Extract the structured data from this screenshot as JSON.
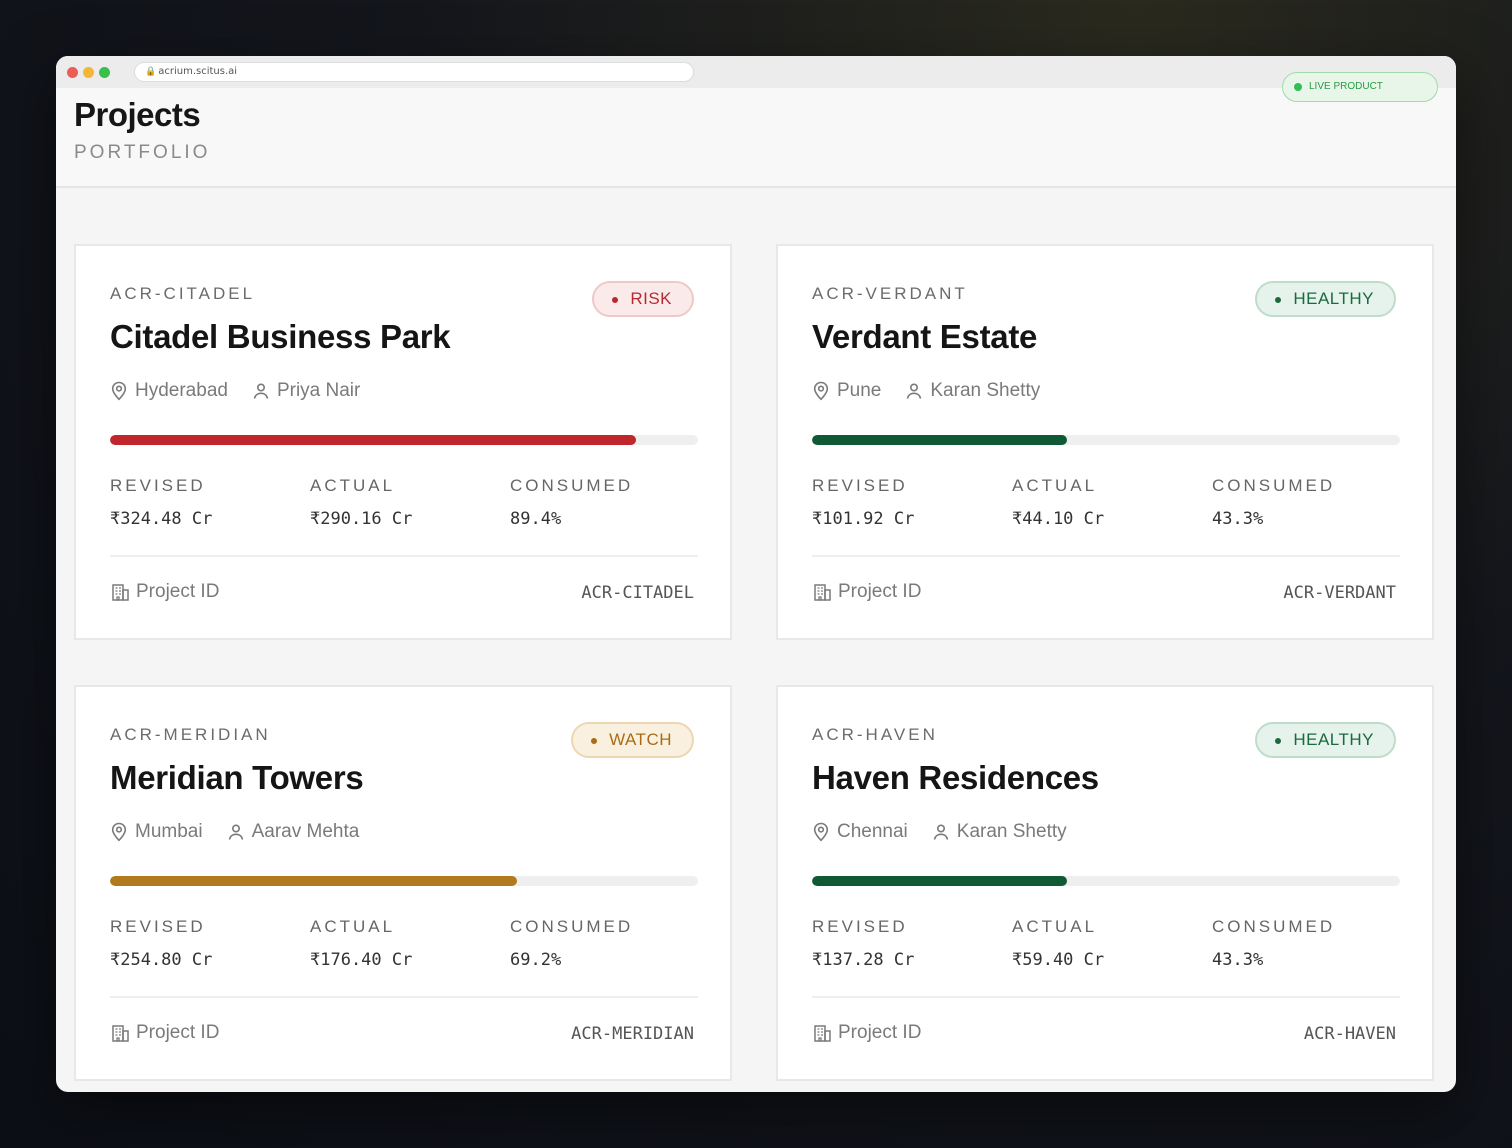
{
  "browser": {
    "url": "acrium.scitus.ai",
    "live_label": "LIVE PRODUCT"
  },
  "header": {
    "title": "Projects",
    "subtitle": "PORTFOLIO"
  },
  "stat_labels": {
    "revised": "REVISED",
    "actual": "ACTUAL",
    "consumed": "CONSUMED",
    "project_id": "Project ID"
  },
  "projects": [
    {
      "code": "ACR-CITADEL",
      "name": "Citadel Business Park",
      "status": "RISK",
      "status_color": "#b52a2f",
      "city": "Hyderabad",
      "manager": "Priya Nair",
      "progress": 0.894,
      "bar_color": "#c0272d",
      "revised": "₹324.48 Cr",
      "actual": "₹290.16 Cr",
      "consumed": "89.4%",
      "project_id": "ACR-CITADEL"
    },
    {
      "code": "ACR-VERDANT",
      "name": "Verdant Estate",
      "status": "HEALTHY",
      "status_color": "#1b6a3e",
      "city": "Pune",
      "manager": "Karan Shetty",
      "progress": 0.433,
      "bar_color": "#0f5a34",
      "revised": "₹101.92 Cr",
      "actual": "₹44.10 Cr",
      "consumed": "43.3%",
      "project_id": "ACR-VERDANT"
    },
    {
      "code": "ACR-MERIDIAN",
      "name": "Meridian Towers",
      "status": "WATCH",
      "status_color": "#a86d14",
      "city": "Mumbai",
      "manager": "Aarav Mehta",
      "progress": 0.692,
      "bar_color": "#b27a1e",
      "revised": "₹254.80 Cr",
      "actual": "₹176.40 Cr",
      "consumed": "69.2%",
      "project_id": "ACR-MERIDIAN"
    },
    {
      "code": "ACR-HAVEN",
      "name": "Haven Residences",
      "status": "HEALTHY",
      "status_color": "#1b6a3e",
      "city": "Chennai",
      "manager": "Karan Shetty",
      "progress": 0.433,
      "bar_color": "#0f5a34",
      "revised": "₹137.28 Cr",
      "actual": "₹59.40 Cr",
      "consumed": "43.3%",
      "project_id": "ACR-HAVEN"
    }
  ]
}
